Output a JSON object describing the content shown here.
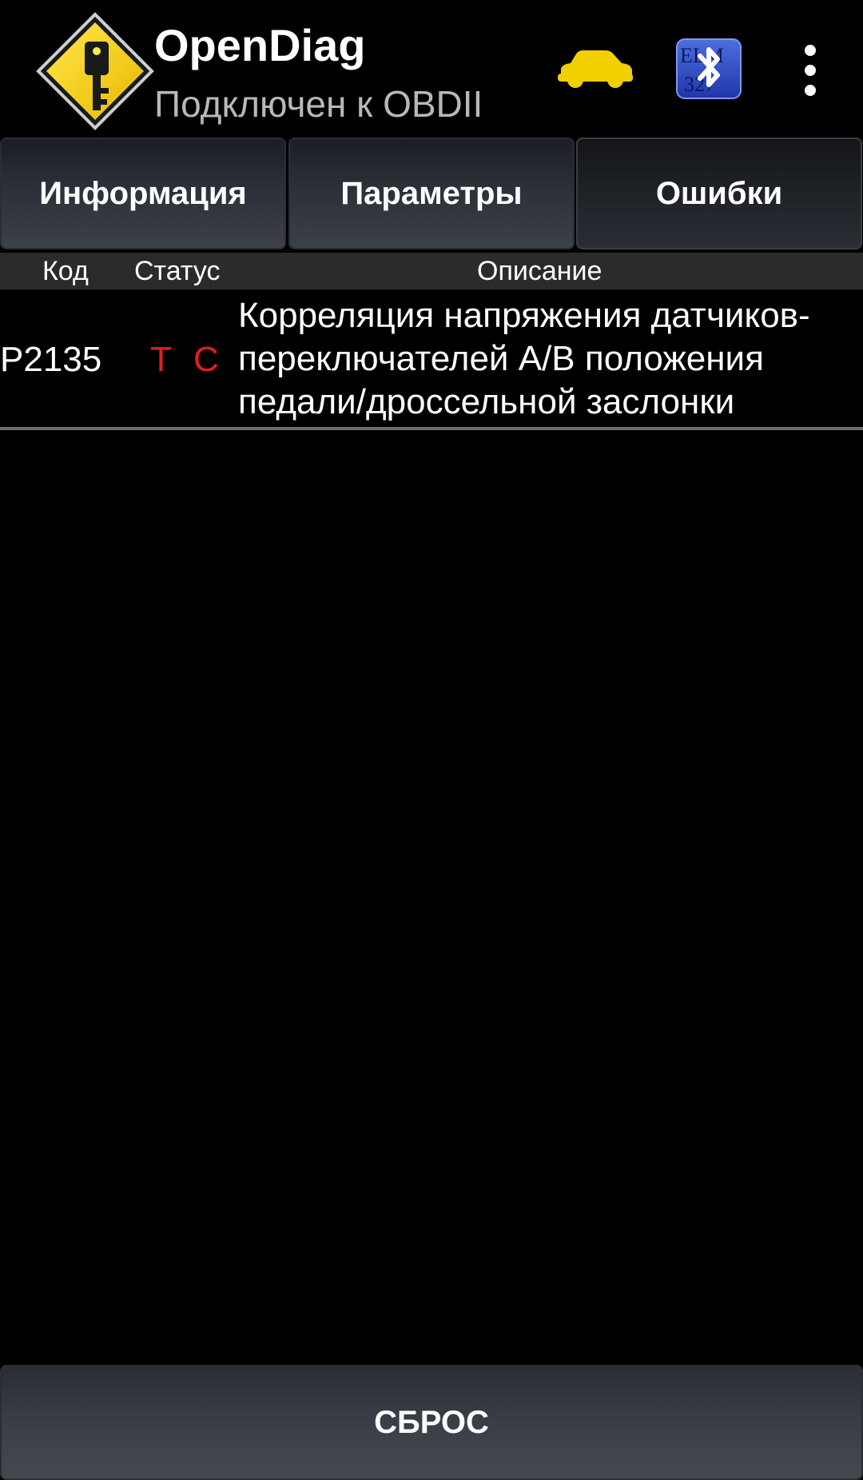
{
  "app": {
    "title": "OpenDiag",
    "subtitle": "Подключен к OBDII",
    "logo_icon": "key-warning-sign-icon",
    "car_icon": "car-icon",
    "elm_icon": "elm327-bluetooth-icon",
    "menu_icon": "overflow-menu-icon"
  },
  "tabs": [
    {
      "label": "Информация",
      "active": false
    },
    {
      "label": "Параметры",
      "active": false
    },
    {
      "label": "Ошибки",
      "active": true
    }
  ],
  "table": {
    "columns": [
      "Код",
      "Статус",
      "Описание"
    ],
    "rows": [
      {
        "code": "P2135",
        "status": [
          "T",
          "C"
        ],
        "description": "Корреляция напряжения датчиков-\nпереключателей A/B положения\nпедали/дроссельной заслонки"
      }
    ]
  },
  "reset_button": {
    "label": "СБРОС"
  },
  "colors": {
    "background": "#000000",
    "status_flag": "#e01e1e",
    "logo_yellow": "#f5d000",
    "subtitle_gray": "#b8b8b8"
  }
}
